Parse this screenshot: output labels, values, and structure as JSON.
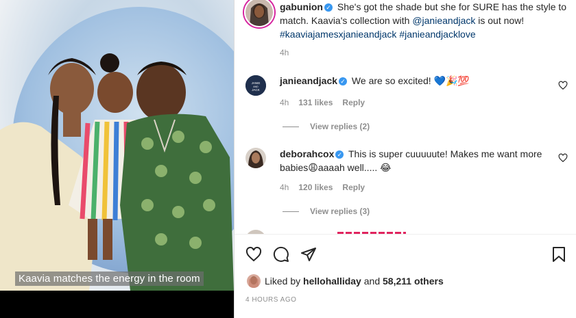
{
  "media": {
    "caption": "Kaavia matches  the energy in the room"
  },
  "post": {
    "username": "gabunion",
    "caption_text": " She's got the shade but she for SURE has the style to match. Kaavia's collection with ",
    "mention": "@janieandjack",
    "caption_tail": " is out now!",
    "hashtag1": "#kaaviajamesxjanieandjack",
    "hashtag2": "#janieandjacklove",
    "time": "4h"
  },
  "comments": [
    {
      "username": "janieandjack",
      "text": " We are so excited! 💙🎉💯",
      "time": "4h",
      "likes": "131 likes",
      "reply": "Reply",
      "view_replies": "View replies (2)"
    },
    {
      "username": "deborahcox",
      "text": " This is super cuuuuute! Makes me want more babies😩aaaah well..... 😂",
      "time": "4h",
      "likes": "120 likes",
      "reply": "Reply",
      "view_replies": "View replies (3)"
    }
  ],
  "actions": {
    "liked_prefix": "Liked by ",
    "liked_user": "hellohalliday",
    "liked_and": " and ",
    "liked_count": "58,211 others",
    "timestamp": "4 HOURS AGO"
  },
  "icons": {
    "verified": "verified-badge-icon",
    "like": "heart-icon",
    "comment": "comment-icon",
    "share": "paper-plane-icon",
    "save": "bookmark-icon"
  },
  "colors": {
    "verified": "#3897f0",
    "link": "#00376b",
    "muted": "#8e8e8e"
  }
}
